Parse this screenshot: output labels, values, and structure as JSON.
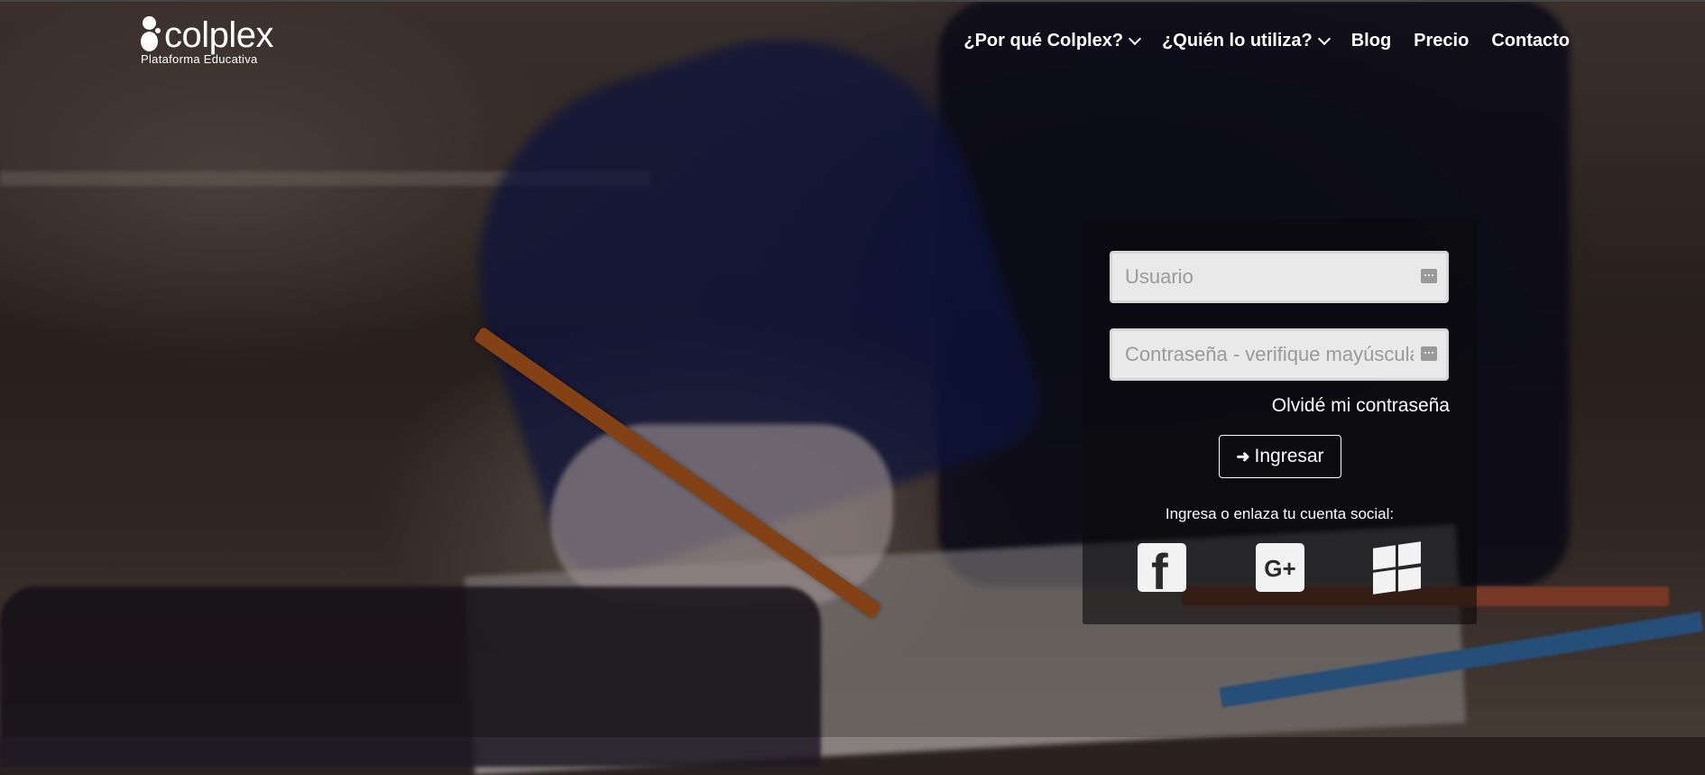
{
  "brand": {
    "name": "colplex",
    "tagline": "Plataforma Educativa"
  },
  "nav": {
    "items": [
      {
        "label": "¿Por qué Colplex?",
        "dropdown": true
      },
      {
        "label": "¿Quién lo utiliza?",
        "dropdown": true
      },
      {
        "label": "Blog",
        "dropdown": false
      },
      {
        "label": "Precio",
        "dropdown": false
      },
      {
        "label": "Contacto",
        "dropdown": false
      }
    ]
  },
  "login": {
    "username_placeholder": "Usuario",
    "password_placeholder": "Contraseña - verifique mayúsculas",
    "forgot_label": "Olvidé mi contraseña",
    "submit_label": "Ingresar",
    "social_caption": "Ingresa o enlaza tu cuenta social:",
    "social": [
      {
        "icon": "facebook-icon",
        "glyph": "f"
      },
      {
        "icon": "google-plus-icon",
        "glyph": "G+"
      },
      {
        "icon": "windows-icon"
      }
    ]
  },
  "colors": {
    "panel_bg": "rgba(10,10,12,0.6)",
    "text": "#ffffff",
    "field_bg": "#e9e9e9"
  }
}
